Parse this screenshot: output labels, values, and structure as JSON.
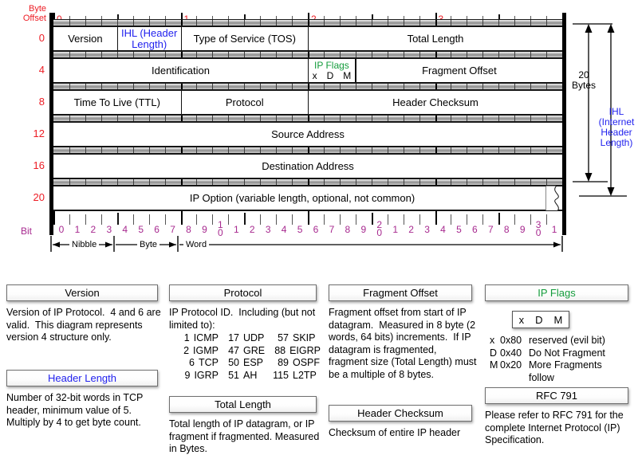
{
  "diagram": {
    "corner_label_line1": "Byte",
    "corner_label_line2": "Offset",
    "bit_label": "Bit",
    "byte_offsets": [
      "0",
      "4",
      "8",
      "12",
      "16",
      "20"
    ],
    "top_ruler_bytes": [
      "0",
      "1",
      "2",
      "3"
    ],
    "bit_numbers": [
      "0",
      "1",
      "2",
      "3",
      "4",
      "5",
      "6",
      "7",
      "8",
      "9",
      "10",
      "1",
      "2",
      "3",
      "4",
      "5",
      "6",
      "7",
      "8",
      "9",
      "20",
      "1",
      "2",
      "3",
      "4",
      "5",
      "6",
      "7",
      "8",
      "9",
      "30",
      "1"
    ],
    "measures": [
      "Nibble",
      "Byte",
      "Word"
    ],
    "rows": [
      {
        "offset": "0",
        "cells": [
          {
            "label": "Version",
            "bits": 4,
            "style": "plain"
          },
          {
            "label": "IHL (Header Length)",
            "bits": 4,
            "style": "blue"
          },
          {
            "label": "Type of Service (TOS)",
            "bits": 8,
            "style": "plain"
          },
          {
            "label": "Total Length",
            "bits": 16,
            "style": "plain"
          }
        ]
      },
      {
        "offset": "4",
        "cells": [
          {
            "label": "Identification",
            "bits": 16,
            "style": "plain"
          },
          {
            "label": "IP Flags",
            "sublabels": [
              "x",
              "D",
              "M"
            ],
            "bits": 3,
            "style": "flags"
          },
          {
            "label": "Fragment Offset",
            "bits": 13,
            "style": "plain"
          }
        ]
      },
      {
        "offset": "8",
        "cells": [
          {
            "label": "Time To Live (TTL)",
            "bits": 8,
            "style": "plain"
          },
          {
            "label": "Protocol",
            "bits": 8,
            "style": "plain"
          },
          {
            "label": "Header Checksum",
            "bits": 16,
            "style": "plain"
          }
        ]
      },
      {
        "offset": "12",
        "cells": [
          {
            "label": "Source Address",
            "bits": 32,
            "style": "plain"
          }
        ]
      },
      {
        "offset": "16",
        "cells": [
          {
            "label": "Destination Address",
            "bits": 32,
            "style": "plain"
          }
        ]
      },
      {
        "offset": "20",
        "cells": [
          {
            "label": "IP Option (variable length, optional, not common)",
            "bits": 32,
            "style": "wavy"
          }
        ]
      }
    ],
    "brace_bytes_line1": "20",
    "brace_bytes_line2": "Bytes",
    "brace_ihl": "IHL\n(Internet\nHeader\nLength)"
  },
  "legends": {
    "version": {
      "title": "Version",
      "body": "Version of IP Protocol.  4 and 6 are valid.  This diagram represents version 4 structure only."
    },
    "header_length": {
      "title": "Header Length",
      "body": "Number of 32-bit words in TCP header, minimum value of 5.  Multiply by 4 to get byte count."
    },
    "protocol": {
      "title": "Protocol",
      "body": "IP Protocol ID.  Including (but not limited to):",
      "entries": [
        {
          "num": "1",
          "name": "ICMP"
        },
        {
          "num": "17",
          "name": "UDP"
        },
        {
          "num": "57",
          "name": "SKIP"
        },
        {
          "num": "2",
          "name": "IGMP"
        },
        {
          "num": "47",
          "name": "GRE"
        },
        {
          "num": "88",
          "name": "EIGRP"
        },
        {
          "num": "6",
          "name": "TCP"
        },
        {
          "num": "50",
          "name": "ESP"
        },
        {
          "num": "89",
          "name": "OSPF"
        },
        {
          "num": "9",
          "name": "IGRP"
        },
        {
          "num": "51",
          "name": "AH"
        },
        {
          "num": "115",
          "name": "L2TP"
        }
      ]
    },
    "total_length": {
      "title": "Total Length",
      "body": "Total length of IP datagram, or IP fragment if fragmented. Measured in Bytes."
    },
    "fragment_offset": {
      "title": "Fragment Offset",
      "body": "Fragment offset from start of IP datagram.  Measured in 8 byte (2 words, 64 bits) increments.  If IP datagram is fragmented, fragment size (Total Length) must be a multiple of 8 bytes."
    },
    "header_checksum": {
      "title": "Header Checksum",
      "body": "Checksum of entire IP header"
    },
    "ip_flags": {
      "title": "IP Flags",
      "box": [
        "x",
        "D",
        "M"
      ],
      "items": [
        {
          "key": "x",
          "hex": "0x80",
          "desc": "reserved (evil bit)"
        },
        {
          "key": "D",
          "hex": "0x40",
          "desc": "Do Not Fragment"
        },
        {
          "key": "M",
          "hex": "0x20",
          "desc": "More Fragments"
        }
      ],
      "continuation": "follow"
    },
    "rfc": {
      "title": "RFC 791",
      "body": "Please refer to RFC 791 for the complete Internet Protocol (IP) Specification."
    }
  },
  "colors": {
    "byte_offset": "#ed1c24",
    "bit_number": "#a7298f",
    "ihl_blue": "#2222ee",
    "flags_green": "#139c3b"
  }
}
